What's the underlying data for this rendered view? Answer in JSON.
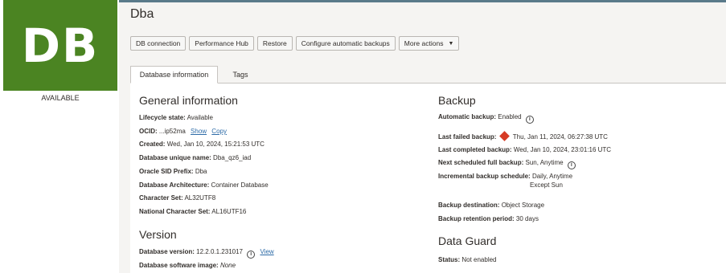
{
  "sidebar": {
    "tile_label": "DB",
    "status": "AVAILABLE"
  },
  "header": {
    "title": "Dba"
  },
  "actions": {
    "db_connection": "DB connection",
    "performance_hub": "Performance Hub",
    "restore": "Restore",
    "configure_backups": "Configure automatic backups",
    "more_actions": "More actions"
  },
  "tabs": {
    "database_information": "Database information",
    "tags": "Tags"
  },
  "general": {
    "title": "General information",
    "lifecycle_label": "Lifecycle state:",
    "lifecycle_value": "Available",
    "ocid_label": "OCID:",
    "ocid_value": "...ip52ma",
    "ocid_show": "Show",
    "ocid_copy": "Copy",
    "created_label": "Created:",
    "created_value": "Wed, Jan 10, 2024, 15:21:53 UTC",
    "unique_name_label": "Database unique name:",
    "unique_name_value": "Dba_qz6_iad",
    "sid_label": "Oracle SID Prefix:",
    "sid_value": "Dba",
    "arch_label": "Database Architecture:",
    "arch_value": "Container Database",
    "charset_label": "Character Set:",
    "charset_value": "AL32UTF8",
    "ncharset_label": "National Character Set:",
    "ncharset_value": "AL16UTF16"
  },
  "version": {
    "title": "Version",
    "db_version_label": "Database version:",
    "db_version_value": "12.2.0.1.231017",
    "view_link": "View",
    "sw_image_label": "Database software image:",
    "sw_image_value": "None"
  },
  "backup": {
    "title": "Backup",
    "auto_label": "Automatic backup:",
    "auto_value": "Enabled",
    "last_failed_label": "Last failed backup:",
    "last_failed_value": "Thu, Jan 11, 2024, 06:27:38 UTC",
    "last_completed_label": "Last completed backup:",
    "last_completed_value": "Wed, Jan 10, 2024, 23:01:16 UTC",
    "next_full_label": "Next scheduled full backup:",
    "next_full_value": "Sun, Anytime",
    "incremental_label": "Incremental backup schedule:",
    "incremental_value": "Daily, Anytime",
    "incremental_except": "Except Sun",
    "destination_label": "Backup destination:",
    "destination_value": "Object Storage",
    "retention_label": "Backup retention period:",
    "retention_value": "30 days"
  },
  "data_guard": {
    "title": "Data Guard",
    "status_label": "Status:",
    "status_value": "Not enabled"
  },
  "colors": {
    "tile": "#4b8422",
    "link": "#2d6ba7",
    "error": "#d63b25"
  }
}
